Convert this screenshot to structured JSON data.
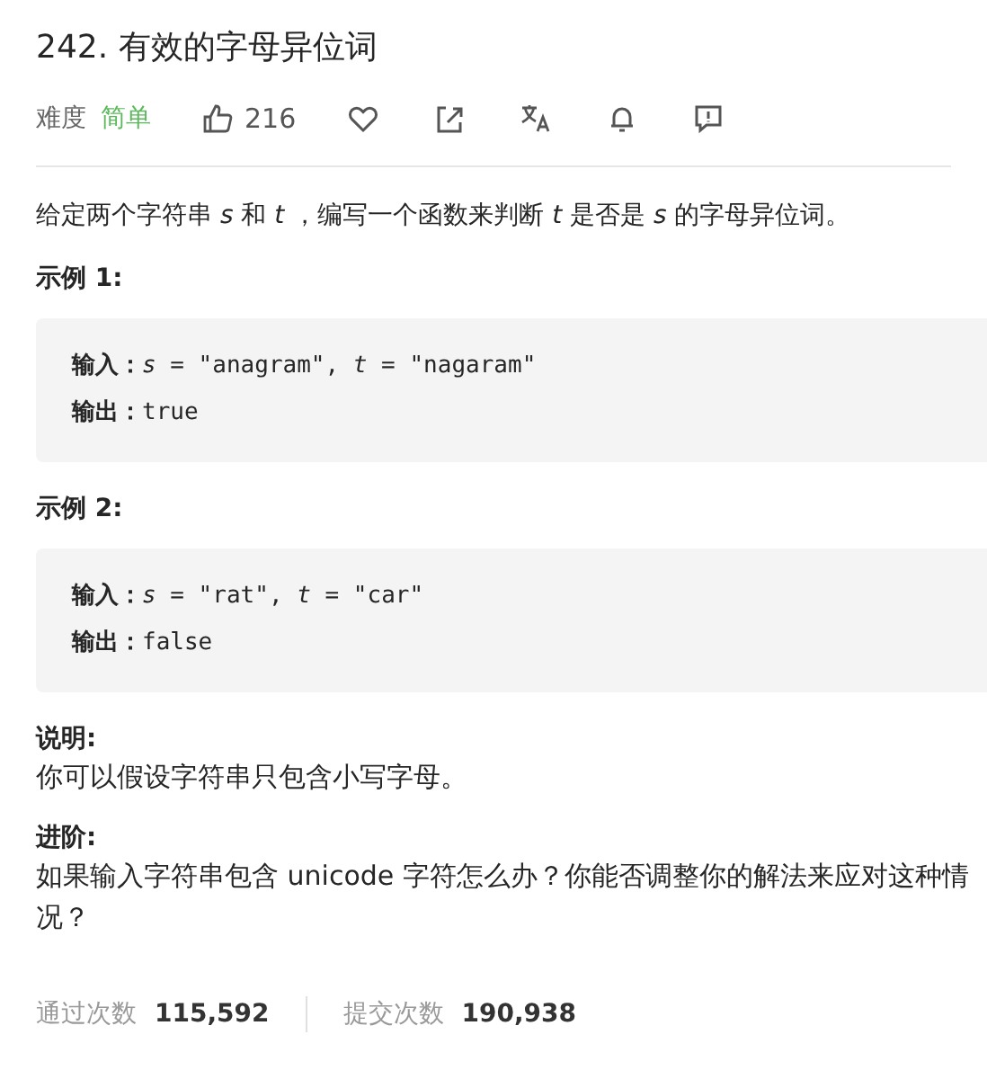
{
  "title": "242. 有效的字母异位词",
  "meta": {
    "difficulty_label": "难度",
    "difficulty": "简单",
    "likes": "216"
  },
  "description": "给定两个字符串 *s* 和 *t* ，编写一个函数来判断 *t* 是否是 *s* 的字母异位词。",
  "examples": [
    {
      "heading": "示例 1:",
      "lines": [
        {
          "label": "输入：",
          "value": "*s* = \"anagram\", *t* = \"nagaram\""
        },
        {
          "label": "输出：",
          "value": "true"
        }
      ]
    },
    {
      "heading": "示例 2:",
      "lines": [
        {
          "label": "输入：",
          "value": "*s* = \"rat\", *t* = \"car\""
        },
        {
          "label": "输出：",
          "value": "false"
        }
      ]
    }
  ],
  "notes": [
    {
      "heading": "说明:",
      "text": "你可以假设字符串只包含小写字母。"
    },
    {
      "heading": "进阶:",
      "text": "如果输入字符串包含 unicode 字符怎么办？你能否调整你的解法来应对这种情况？"
    }
  ],
  "stats": [
    {
      "label": "通过次数",
      "value": "115,592"
    },
    {
      "label": "提交次数",
      "value": "190,938"
    }
  ]
}
